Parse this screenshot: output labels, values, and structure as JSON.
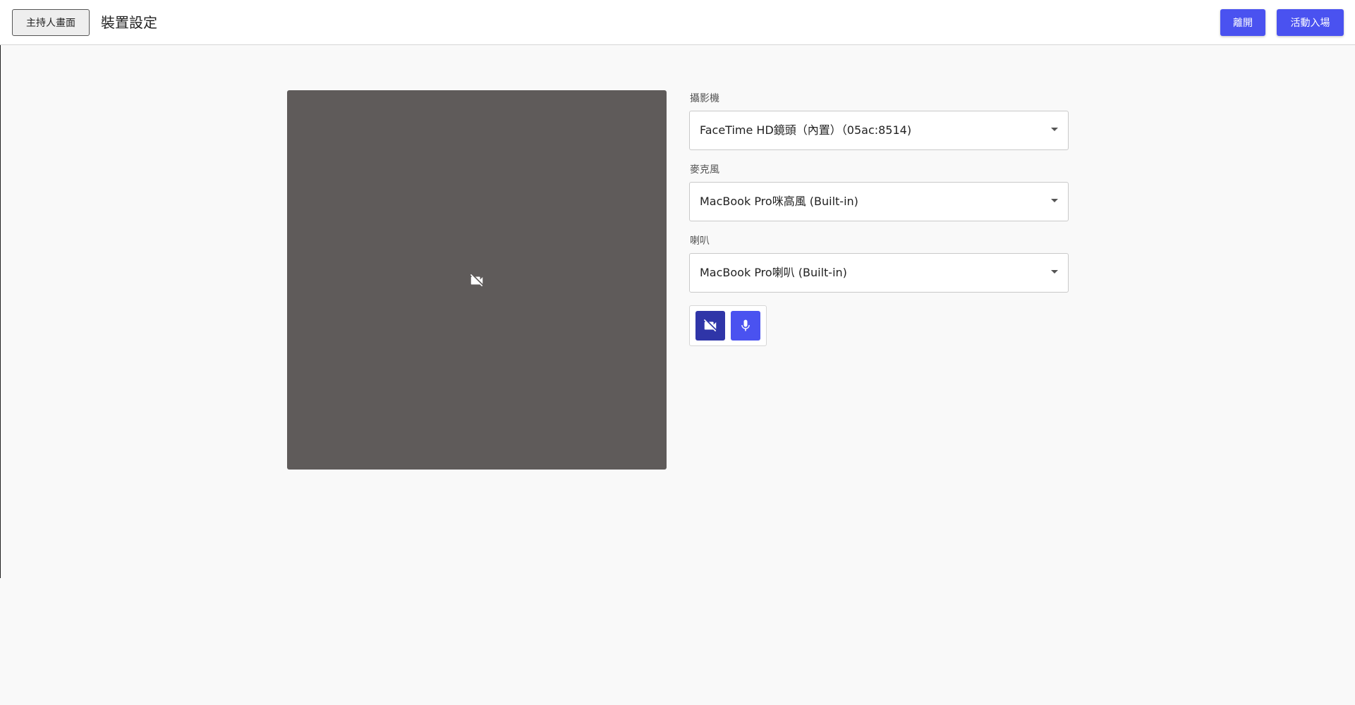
{
  "header": {
    "host_view_label": "主持人畫面",
    "title": "裝置設定",
    "leave_label": "離開",
    "enter_label": "活動入場",
    "accent_color": "#4a52f0"
  },
  "preview": {
    "state_icon": "video-off-icon",
    "background_color": "#5f5b5a"
  },
  "devices": {
    "camera": {
      "label": "攝影機",
      "value": "FaceTime HD鏡頭（內置）（05ac:8514)"
    },
    "microphone": {
      "label": "麥克風",
      "value": "MacBook Pro咪高風 (Built-in)"
    },
    "speaker": {
      "label": "喇叭",
      "value": "MacBook Pro喇叭 (Built-in)"
    }
  },
  "controls": {
    "camera_toggle_icon": "video-off-icon",
    "mic_toggle_icon": "microphone-icon",
    "camera_toggle_color": "#2f35a8",
    "mic_toggle_color": "#4a52f0"
  }
}
